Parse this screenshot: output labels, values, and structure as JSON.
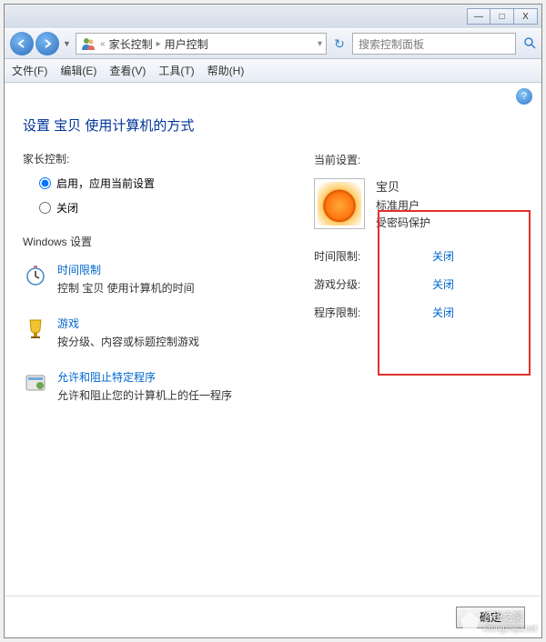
{
  "titlebar": {
    "minimize": "—",
    "maximize": "□",
    "close": "X"
  },
  "breadcrumb": {
    "items": [
      "家长控制",
      "用户控制"
    ]
  },
  "search": {
    "placeholder": "搜索控制面板"
  },
  "menu": {
    "file": "文件(F)",
    "edit": "编辑(E)",
    "view": "查看(V)",
    "tools": "工具(T)",
    "help": "帮助(H)"
  },
  "page": {
    "title": "设置 宝贝 使用计算机的方式",
    "parental_label": "家长控制:",
    "radio_on": "启用，应用当前设置",
    "radio_off": "关闭",
    "win_settings": "Windows 设置"
  },
  "settings": [
    {
      "link": "时间限制",
      "desc": "控制 宝贝 使用计算机的时间"
    },
    {
      "link": "游戏",
      "desc": "按分级、内容或标题控制游戏"
    },
    {
      "link": "允许和阻止特定程序",
      "desc": "允许和阻止您的计算机上的任一程序"
    }
  ],
  "right": {
    "current": "当前设置:",
    "user": {
      "name": "宝贝",
      "type": "标准用户",
      "protection": "受密码保护"
    },
    "status": [
      {
        "key": "时间限制:",
        "val": "关闭"
      },
      {
        "key": "游戏分级:",
        "val": "关闭"
      },
      {
        "key": "程序限制:",
        "val": "关闭"
      }
    ]
  },
  "footer": {
    "ok": "确定"
  },
  "watermark": {
    "text1": "系统之家",
    "text2": "xitongzhijia.net"
  }
}
